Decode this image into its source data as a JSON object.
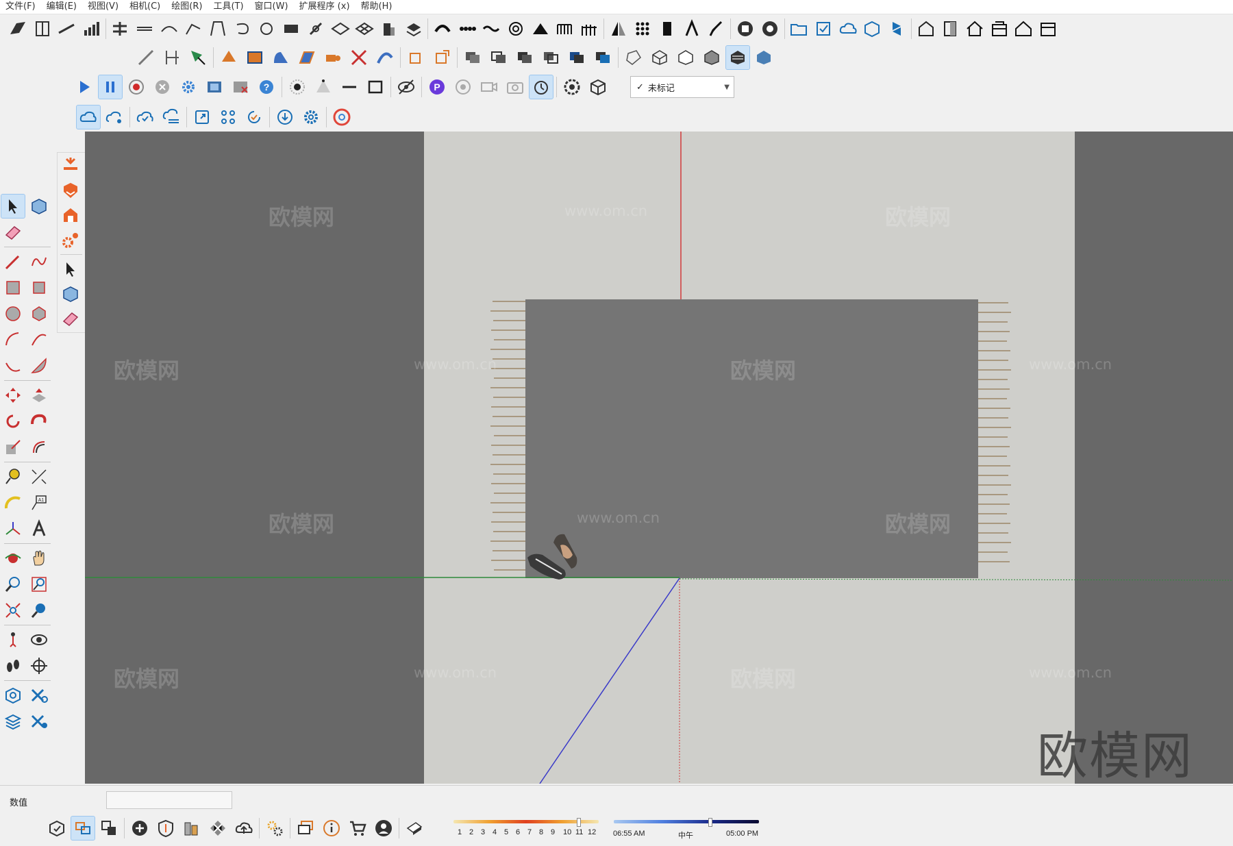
{
  "menu": [
    "文件(F)",
    "编辑(E)",
    "视图(V)",
    "相机(C)",
    "绘图(R)",
    "工具(T)",
    "窗口(W)",
    "扩展程序 (x)",
    "帮助(H)"
  ],
  "tag_selector": {
    "check": "✓",
    "value": "未标记"
  },
  "watermark": {
    "brand": "欧模网",
    "url": "www.om.cn"
  },
  "status": {
    "measurements_label": "数值",
    "measurements_value": "",
    "shadow_months": [
      "1",
      "2",
      "3",
      "4",
      "5",
      "6",
      "7",
      "8",
      "9",
      "10",
      "11",
      "12"
    ],
    "time_start": "06:55 AM",
    "time_noon": "中午",
    "time_end": "05:00 PM"
  },
  "colors": {
    "axis_red": "#d23a3a",
    "axis_green": "#2f8a3a",
    "axis_blue": "#3a3ac8",
    "rug": "#757575",
    "floor": "#cfcfcb",
    "backdrop": "#686868"
  }
}
